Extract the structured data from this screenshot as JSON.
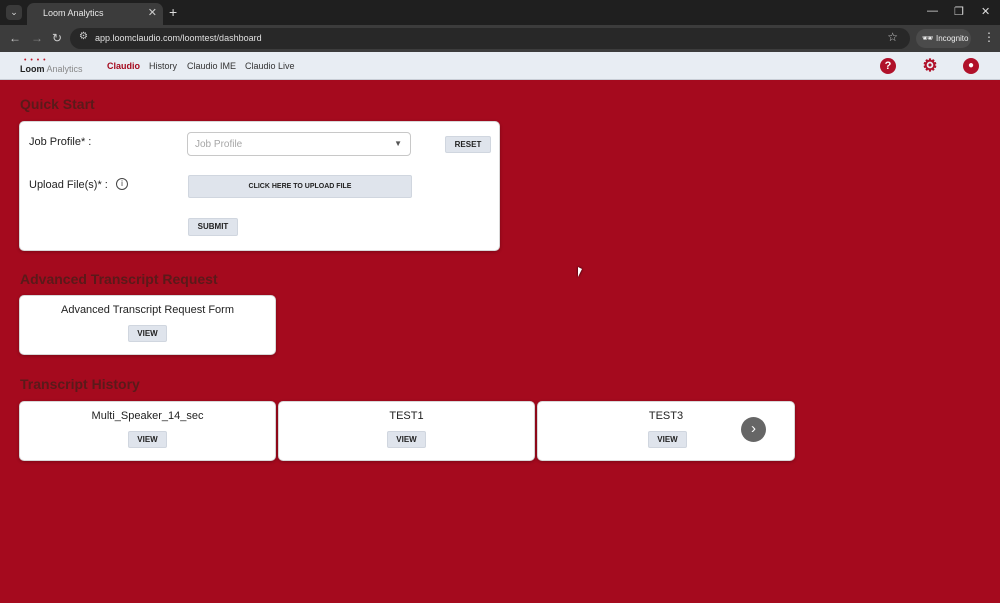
{
  "browser": {
    "tab_title": "Loom Analytics",
    "tab_close": "✕",
    "new_tab": "+",
    "url": "app.loomclaudio.com/loomtest/dashboard",
    "incognito_label": "Incognito",
    "window_controls": [
      "—",
      "❐",
      "✕"
    ]
  },
  "app": {
    "logo_brand": "Loom",
    "logo_sub": " Analytics",
    "nav": [
      "Claudio",
      "History",
      "Claudio IME",
      "Claudio Live"
    ],
    "active_nav": "Claudio",
    "accent_color": "#a50a1e"
  },
  "quick_start": {
    "title": "Quick Start",
    "job_profile_label": "Job Profile* :",
    "job_profile_placeholder": "Job Profile",
    "reset_label": "RESET",
    "upload_label": "Upload File(s)* :",
    "upload_button": "CLICK HERE TO UPLOAD FILE",
    "submit_label": "SUBMIT"
  },
  "advanced": {
    "title": "Advanced Transcript Request",
    "card_title": "Advanced Transcript Request Form",
    "view_label": "VIEW"
  },
  "history": {
    "title": "Transcript History",
    "items": [
      {
        "name": "Multi_Speaker_14_sec",
        "view": "VIEW"
      },
      {
        "name": "TEST1",
        "view": "VIEW"
      },
      {
        "name": "TEST3",
        "view": "VIEW"
      }
    ]
  }
}
